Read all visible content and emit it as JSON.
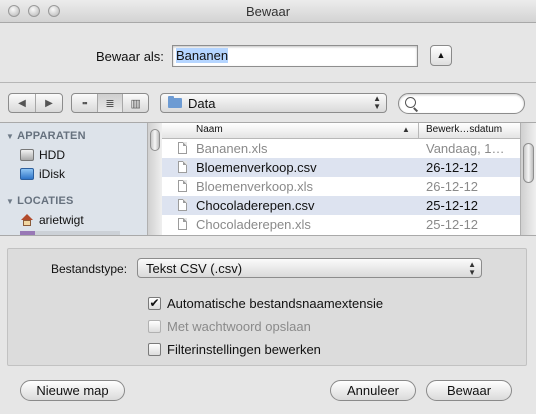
{
  "window": {
    "title": "Bewaar"
  },
  "save_as": {
    "label": "Bewaar als:",
    "value": "Bananen",
    "expand_icon": "disclosure-up-icon"
  },
  "toolbar": {
    "back_icon": "back-arrow-icon",
    "forward_icon": "forward-arrow-icon",
    "view_modes": [
      "icon-view-icon",
      "list-view-icon",
      "column-view-icon"
    ],
    "active_view": "list",
    "path": "Data",
    "search_value": ""
  },
  "sidebar": {
    "sections": [
      {
        "title": "APPARATEN",
        "items": [
          "HDD",
          "iDisk"
        ]
      },
      {
        "title": "LOCATIES",
        "items": [
          "arietwigt"
        ]
      }
    ]
  },
  "file_list": {
    "columns": [
      "Naam",
      "Bewerk…sdatum"
    ],
    "rows": [
      {
        "name": "Bananen.xls",
        "date": "Vandaag, 1…",
        "dimmed": true
      },
      {
        "name": "Bloemenverkoop.csv",
        "date": "26-12-12",
        "dimmed": false
      },
      {
        "name": "Bloemenverkoop.xls",
        "date": "26-12-12",
        "dimmed": true
      },
      {
        "name": "Chocoladerepen.csv",
        "date": "25-12-12",
        "dimmed": false
      },
      {
        "name": "Chocoladerepen.xls",
        "date": "25-12-12",
        "dimmed": true
      }
    ]
  },
  "format": {
    "label": "Bestandstype:",
    "value": "Tekst CSV (.csv)"
  },
  "options": [
    {
      "label": "Automatische bestandsnaamextensie",
      "checked": true,
      "enabled": true
    },
    {
      "label": "Met wachtwoord opslaan",
      "checked": false,
      "enabled": false
    },
    {
      "label": "Filterinstellingen bewerken",
      "checked": false,
      "enabled": true
    }
  ],
  "buttons": {
    "new_folder": "Nieuwe map",
    "cancel": "Annuleer",
    "save": "Bewaar"
  },
  "colors": {
    "selection_blue": "#b5d5ff",
    "row_alt": "#dde3f0",
    "sidebar_bg": "#dde3ea"
  }
}
